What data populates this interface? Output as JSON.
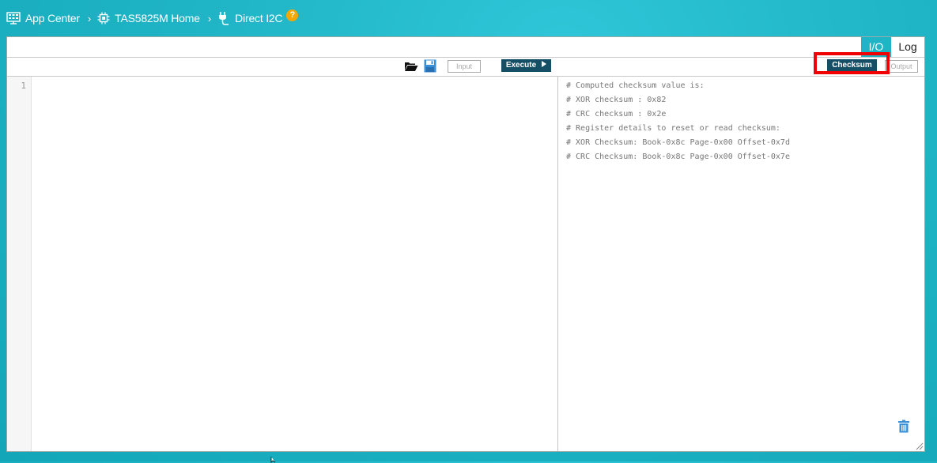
{
  "breadcrumb": {
    "items": [
      {
        "label": "App Center",
        "icon": "app-center-icon"
      },
      {
        "label": "TAS5825M Home",
        "icon": "chip-icon"
      },
      {
        "label": "Direct I2C",
        "icon": "plug-icon"
      }
    ],
    "separator": "›",
    "help": "?"
  },
  "tabs": {
    "io": "I/O",
    "log": "Log"
  },
  "toolbar": {
    "input_label": "Input",
    "execute_label": "Execute",
    "checksum_label": "Checksum",
    "output_label": "Output"
  },
  "editor": {
    "line_numbers": [
      "1"
    ]
  },
  "output": {
    "lines": [
      "# Computed checksum value is:",
      "# XOR checksum : 0x82",
      "# CRC checksum : 0x2e",
      "# Register details to reset or read checksum:",
      "# XOR Checksum: Book-0x8c Page-0x00 Offset-0x7d",
      "# CRC Checksum: Book-0x8c Page-0x00 Offset-0x7e"
    ]
  },
  "colors": {
    "background": "#1fb4c6",
    "accent": "#1fb4c6",
    "dark_button": "#154f66",
    "highlight": "#f00000",
    "help_badge": "#f5a700",
    "save_icon": "#3a8fd6",
    "trash_icon": "#3a8fd6"
  }
}
